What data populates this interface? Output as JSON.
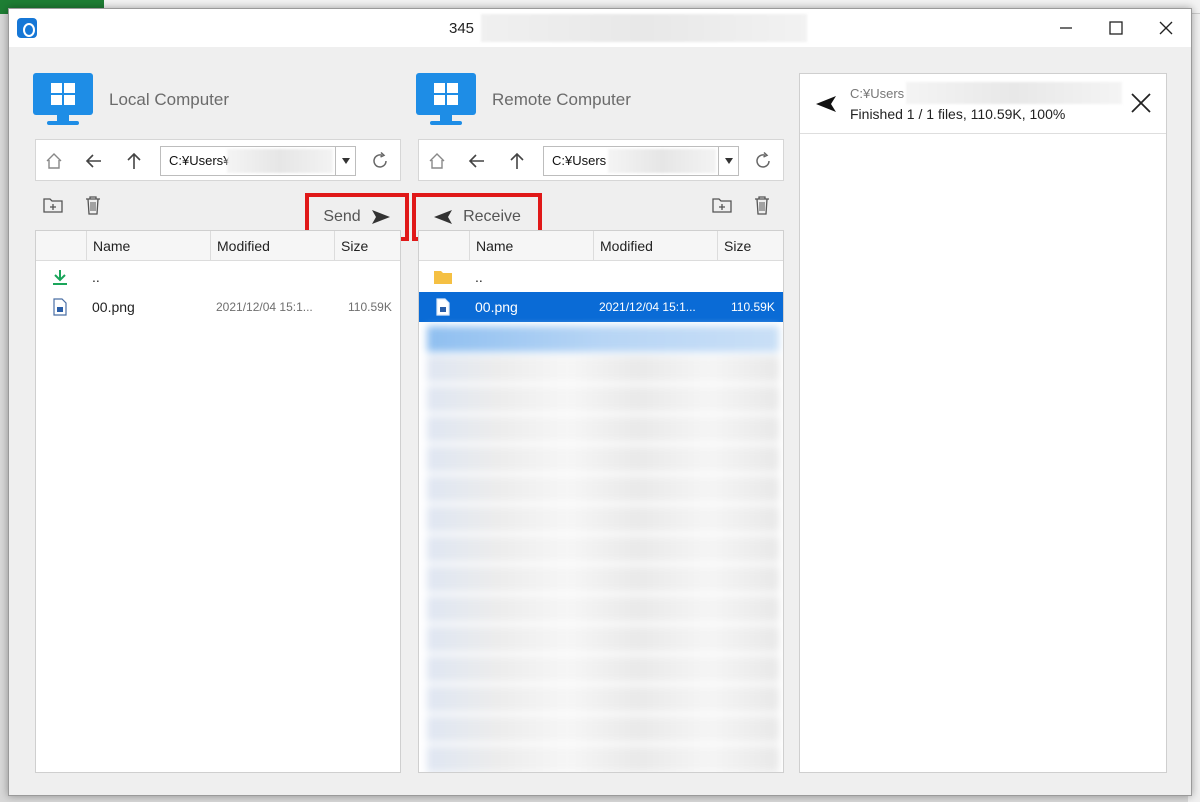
{
  "window": {
    "title": "345"
  },
  "local": {
    "title": "Local Computer",
    "path": "C:¥Users¥",
    "send_label": "Send",
    "columns": [
      "Name",
      "Modified",
      "Size"
    ],
    "rows": [
      {
        "name": "..",
        "modified": "",
        "size": ""
      },
      {
        "name": "00.png",
        "modified": "2021/12/04 15:1...",
        "size": "110.59K"
      }
    ]
  },
  "remote": {
    "title": "Remote Computer",
    "path": "C:¥Users",
    "receive_label": "Receive",
    "columns": [
      "Name",
      "Modified",
      "Size"
    ],
    "rows": [
      {
        "name": "..",
        "modified": "",
        "size": ""
      },
      {
        "name": "00.png",
        "modified": "2021/12/04 15:1...",
        "size": "110.59K"
      }
    ]
  },
  "transfer": {
    "path": "C:¥Users",
    "status": "Finished 1 / 1 files, 110.59K, 100%"
  },
  "colors": {
    "accent": "#0a6bd6",
    "highlight": "#e01818",
    "monitor": "#1e8de6"
  }
}
